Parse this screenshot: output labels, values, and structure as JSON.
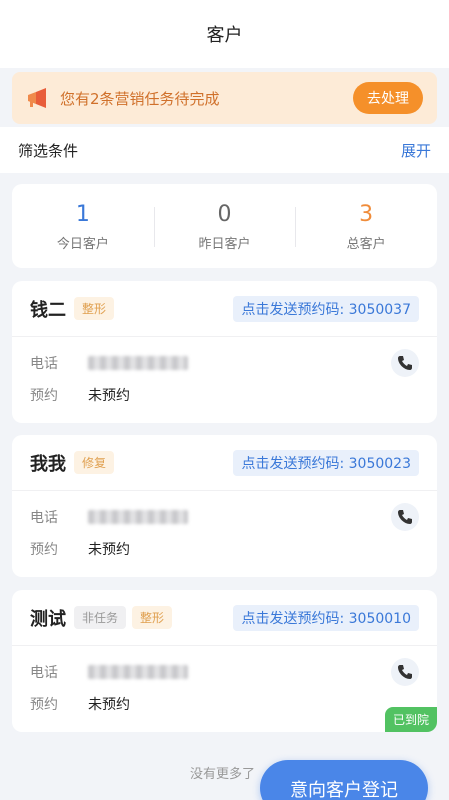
{
  "header": {
    "title": "客户"
  },
  "notice": {
    "text": "您有2条营销任务待完成",
    "button": "去处理"
  },
  "filter": {
    "label": "筛选条件",
    "expand": "展开"
  },
  "stats": [
    {
      "value": "1",
      "label": "今日客户",
      "color": "#3a78d8"
    },
    {
      "value": "0",
      "label": "昨日客户",
      "color": "#666666"
    },
    {
      "value": "3",
      "label": "总客户",
      "color": "#f08c3a"
    }
  ],
  "cards": [
    {
      "name": "钱二",
      "tags": [
        "整形"
      ],
      "code": "点击发送预约码: 3050037",
      "phone_label": "电话",
      "booking_label": "预约",
      "booking_value": "未预约"
    },
    {
      "name": "我我",
      "tags": [
        "修复"
      ],
      "code": "点击发送预约码: 3050023",
      "phone_label": "电话",
      "booking_label": "预约",
      "booking_value": "未预约"
    },
    {
      "name": "测试",
      "tags": [
        "非任务",
        "整形"
      ],
      "code": "点击发送预约码: 3050010",
      "phone_label": "电话",
      "booking_label": "预约",
      "booking_value": "未预约",
      "badge": "已到院"
    }
  ],
  "footer": {
    "no_more": "没有更多了",
    "fab": "意向客户登记"
  },
  "colors": {
    "accent": "#3a78d8",
    "warning": "#f5902a",
    "success": "#52c262"
  }
}
